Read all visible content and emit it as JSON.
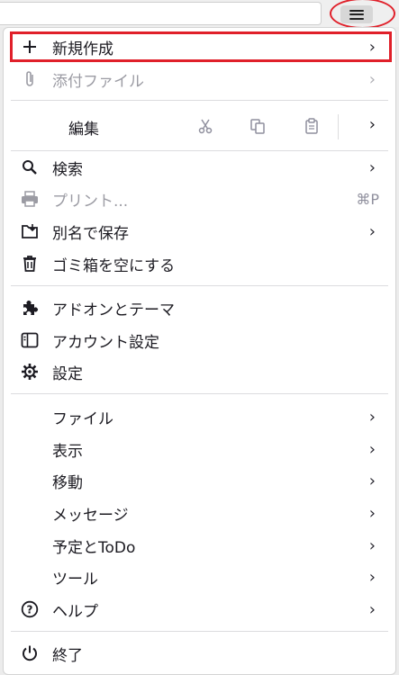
{
  "toolbar": {
    "menu_button_icon": "hamburger-icon"
  },
  "menu": {
    "new": {
      "label": "新規作成",
      "arrow": "›"
    },
    "attach": {
      "label": "添付ファイル",
      "arrow": "›"
    },
    "edit": {
      "label": "編集",
      "arrow": "›",
      "cut_icon": "scissors-icon",
      "copy_icon": "copy-icon",
      "paste_icon": "clipboard-icon"
    },
    "find": {
      "label": "検索",
      "arrow": "›"
    },
    "print": {
      "label": "プリント...",
      "shortcut": "⌘P"
    },
    "save_as": {
      "label": "別名で保存",
      "arrow": "›"
    },
    "empty_trash": {
      "label": "ゴミ箱を空にする"
    },
    "addons": {
      "label": "アドオンとテーマ"
    },
    "account_settings": {
      "label": "アカウント設定"
    },
    "settings": {
      "label": "設定"
    },
    "file": {
      "label": "ファイル",
      "arrow": "›"
    },
    "view": {
      "label": "表示",
      "arrow": "›"
    },
    "go": {
      "label": "移動",
      "arrow": "›"
    },
    "message": {
      "label": "メッセージ",
      "arrow": "›"
    },
    "events_tasks": {
      "label": "予定とToDo",
      "arrow": "›"
    },
    "tools": {
      "label": "ツール",
      "arrow": "›"
    },
    "help": {
      "label": "ヘルプ",
      "arrow": "›"
    },
    "quit": {
      "label": "終了"
    }
  },
  "colors": {
    "highlight": "#e0202a",
    "disabled": "#9b9ba3"
  }
}
